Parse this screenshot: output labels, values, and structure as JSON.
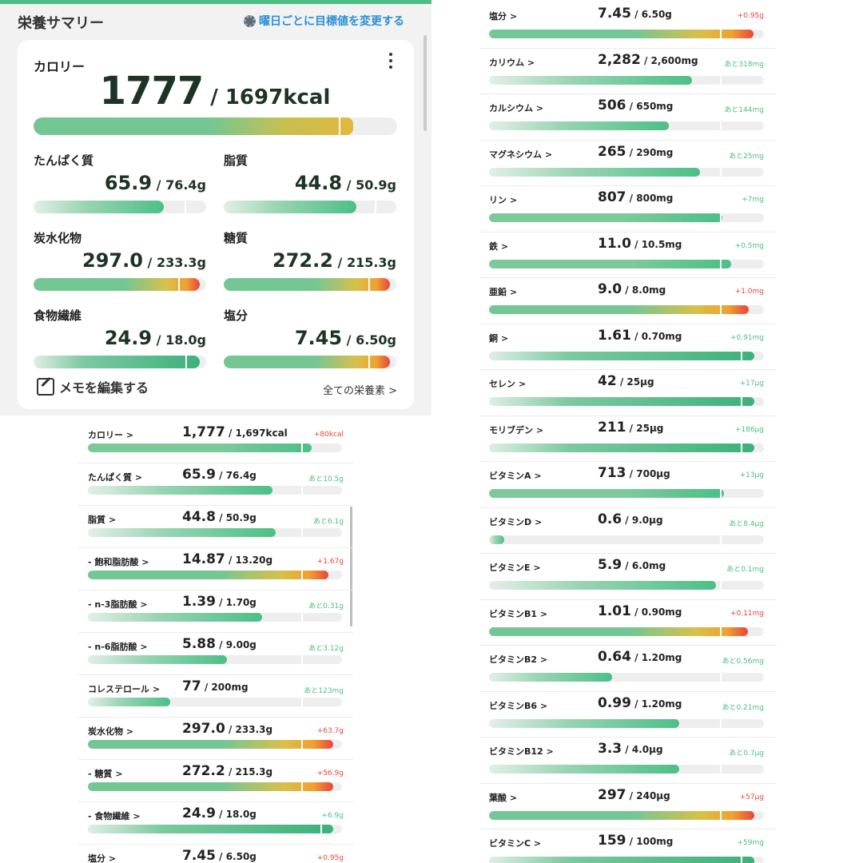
{
  "colors": {
    "accent": "#4cbf86",
    "over": "#e8453c",
    "under": "#4cbf86",
    "link": "#2a8fd8"
  },
  "summary": {
    "title": "栄養サマリー",
    "change_goal": "曜日ごとに目標値を変更する",
    "gear_icon": "gear-icon",
    "calorie": {
      "label": "カロリー",
      "value": "1777",
      "target": " / 1697kcal",
      "progress": 1.047
    },
    "nutrients": [
      {
        "label": "たんぱく質",
        "value": "65.9",
        "target": " / 76.4g",
        "progress": 0.863
      },
      {
        "label": "脂質",
        "value": "44.8",
        "target": " / 50.9g",
        "progress": 0.88
      },
      {
        "label": "炭水化物",
        "value": "297.0",
        "target": " / 233.3g",
        "progress": 1.273
      },
      {
        "label": "糖質",
        "value": "272.2",
        "target": " / 215.3g",
        "progress": 1.264
      },
      {
        "label": "食物繊維",
        "value": "24.9",
        "target": " / 18.0g",
        "progress": 1.383
      },
      {
        "label": "塩分",
        "value": "7.45",
        "target": " / 6.50g",
        "progress": 1.146
      }
    ],
    "memo_label": "メモを編集する",
    "all_nutrients": "全ての栄養素 >"
  },
  "listA": [
    {
      "label": "カロリー >",
      "value": "1,777",
      "target": " / 1,697kcal",
      "diff": "+80kcal",
      "progress": 1.047
    },
    {
      "label": "たんぱく質 >",
      "value": "65.9",
      "target": " / 76.4g",
      "diff": "あと10.5g",
      "progress": 0.863
    },
    {
      "label": "脂質 >",
      "value": "44.8",
      "target": " / 50.9g",
      "diff": "あと6.1g",
      "progress": 0.88
    },
    {
      "label": "- 飽和脂肪酸 >",
      "value": "14.87",
      "target": " / 13.20g",
      "diff": "+1.67g",
      "progress": 1.127
    },
    {
      "label": "- n-3脂肪酸 >",
      "value": "1.39",
      "target": " / 1.70g",
      "diff": "あと0.31g",
      "progress": 0.818
    },
    {
      "label": "- n-6脂肪酸 >",
      "value": "5.88",
      "target": " / 9.00g",
      "diff": "あと3.12g",
      "progress": 0.653
    },
    {
      "label": "コレステロール >",
      "value": "77",
      "target": " / 200mg",
      "diff": "あと123mg",
      "progress": 0.385
    },
    {
      "label": "炭水化物 >",
      "value": "297.0",
      "target": " / 233.3g",
      "diff": "+63.7g",
      "progress": 1.273
    },
    {
      "label": "- 糖質 >",
      "value": "272.2",
      "target": " / 215.3g",
      "diff": "+56.9g",
      "progress": 1.264
    },
    {
      "label": "- 食物繊維 >",
      "value": "24.9",
      "target": " / 18.0g",
      "diff": "+6.9g",
      "progress": 1.383
    },
    {
      "label": "塩分 >",
      "value": "7.45",
      "target": " / 6.50g",
      "diff": "+0.95g",
      "progress": 1.146
    }
  ],
  "listB": [
    {
      "label": "塩分 >",
      "value": "7.45",
      "target": " / 6.50g",
      "diff": "+0.95g",
      "progress": 1.146
    },
    {
      "label": "カリウム >",
      "value": "2,282",
      "target": " / 2,600mg",
      "diff": "あと318mg",
      "progress": 0.878
    },
    {
      "label": "カルシウム >",
      "value": "506",
      "target": " / 650mg",
      "diff": "あと144mg",
      "progress": 0.778
    },
    {
      "label": "マグネシウム >",
      "value": "265",
      "target": " / 290mg",
      "diff": "あと25mg",
      "progress": 0.914
    },
    {
      "label": "リン >",
      "value": "807",
      "target": " / 800mg",
      "diff": "+7mg",
      "progress": 1.009
    },
    {
      "label": "鉄 >",
      "value": "11.0",
      "target": " / 10.5mg",
      "diff": "+0.5mg",
      "progress": 1.048
    },
    {
      "label": "亜鉛 >",
      "value": "9.0",
      "target": " / 8.0mg",
      "diff": "+1.0mg",
      "progress": 1.125
    },
    {
      "label": "銅 >",
      "value": "1.61",
      "target": " / 0.70mg",
      "diff": "+0.91mg",
      "progress": 2.3
    },
    {
      "label": "セレン >",
      "value": "42",
      "target": " / 25µg",
      "diff": "+17µg",
      "progress": 1.68
    },
    {
      "label": "モリブデン >",
      "value": "211",
      "target": " / 25µg",
      "diff": "+186µg",
      "progress": 8.44
    },
    {
      "label": "ビタミンA >",
      "value": "713",
      "target": " / 700µg",
      "diff": "+13µg",
      "progress": 1.019
    },
    {
      "label": "ビタミンD >",
      "value": "0.6",
      "target": " / 9.0µg",
      "diff": "あと8.4µg",
      "progress": 0.067
    },
    {
      "label": "ビタミンE >",
      "value": "5.9",
      "target": " / 6.0mg",
      "diff": "あと0.1mg",
      "progress": 0.983
    },
    {
      "label": "ビタミンB1 >",
      "value": "1.01",
      "target": " / 0.90mg",
      "diff": "+0.11mg",
      "progress": 1.122
    },
    {
      "label": "ビタミンB2 >",
      "value": "0.64",
      "target": " / 1.20mg",
      "diff": "あと0.56mg",
      "progress": 0.533
    },
    {
      "label": "ビタミンB6 >",
      "value": "0.99",
      "target": " / 1.20mg",
      "diff": "あと0.21mg",
      "progress": 0.825
    },
    {
      "label": "ビタミンB12 >",
      "value": "3.3",
      "target": " / 4.0µg",
      "diff": "あと0.7µg",
      "progress": 0.825
    },
    {
      "label": "葉酸 >",
      "value": "297",
      "target": " / 240µg",
      "diff": "+57µg",
      "progress": 1.238
    },
    {
      "label": "ビタミンC >",
      "value": "159",
      "target": " / 100mg",
      "diff": "+59mg",
      "progress": 1.59
    }
  ]
}
